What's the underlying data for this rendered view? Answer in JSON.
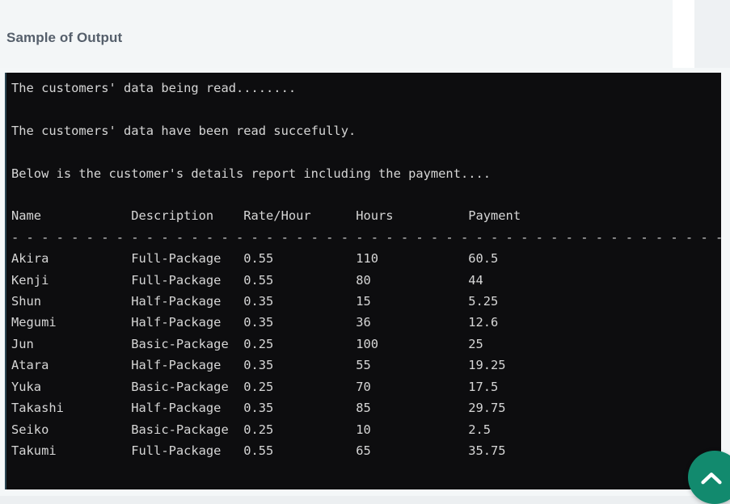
{
  "page": {
    "title": "Sample of Output",
    "accent_color": "#128a6e",
    "panel_color": "#f3f6f7",
    "background_color": "#eef1f3",
    "title_color": "#555f6b"
  },
  "console": {
    "background_color": "#0d0d0f",
    "text_color": "#d6d6d6",
    "lines": {
      "status_reading": "The customers' data being read........",
      "blank_1": "",
      "status_done": "The customers' data have been read succefully.",
      "blank_2": "",
      "intro": "Below is the customer's details report including the payment....",
      "blank_3": "",
      "header": "Name            Description    Rate/Hour      Hours          Payment",
      "separator": "- - - - - - - - - - - - - - - - - - - - - - - - - - - - - - - - - - - - - - - - - - - - - - - - -",
      "rows": [
        "Akira           Full-Package   0.55           110            60.5",
        "Kenji           Full-Package   0.55           80             44",
        "Shun            Half-Package   0.35           15             5.25",
        "Megumi          Half-Package   0.35           36             12.6",
        "Jun             Basic-Package  0.25           100            25",
        "Atara           Half-Package   0.35           55             19.25",
        "Yuka            Basic-Package  0.25           70             17.5",
        "Takashi         Half-Package   0.35           85             29.75",
        "Seiko           Basic-Package  0.25           10             2.5",
        "Takumi          Full-Package   0.55           65             35.75"
      ]
    },
    "report": {
      "columns": [
        "Name",
        "Description",
        "Rate/Hour",
        "Hours",
        "Payment"
      ],
      "records": [
        {
          "name": "Akira",
          "description": "Full-Package",
          "rate_per_hour": "0.55",
          "hours": "110",
          "payment": "60.5"
        },
        {
          "name": "Kenji",
          "description": "Full-Package",
          "rate_per_hour": "0.55",
          "hours": "80",
          "payment": "44"
        },
        {
          "name": "Shun",
          "description": "Half-Package",
          "rate_per_hour": "0.35",
          "hours": "15",
          "payment": "5.25"
        },
        {
          "name": "Megumi",
          "description": "Half-Package",
          "rate_per_hour": "0.35",
          "hours": "36",
          "payment": "12.6"
        },
        {
          "name": "Jun",
          "description": "Basic-Package",
          "rate_per_hour": "0.25",
          "hours": "100",
          "payment": "25"
        },
        {
          "name": "Atara",
          "description": "Half-Package",
          "rate_per_hour": "0.35",
          "hours": "55",
          "payment": "19.25"
        },
        {
          "name": "Yuka",
          "description": "Basic-Package",
          "rate_per_hour": "0.25",
          "hours": "70",
          "payment": "17.5"
        },
        {
          "name": "Takashi",
          "description": "Half-Package",
          "rate_per_hour": "0.35",
          "hours": "85",
          "payment": "29.75"
        },
        {
          "name": "Seiko",
          "description": "Basic-Package",
          "rate_per_hour": "0.25",
          "hours": "10",
          "payment": "2.5"
        },
        {
          "name": "Takumi",
          "description": "Full-Package",
          "rate_per_hour": "0.55",
          "hours": "65",
          "payment": "35.75"
        }
      ]
    }
  },
  "scroll_top_button": {
    "icon": "chevron-up-icon",
    "label": ""
  }
}
